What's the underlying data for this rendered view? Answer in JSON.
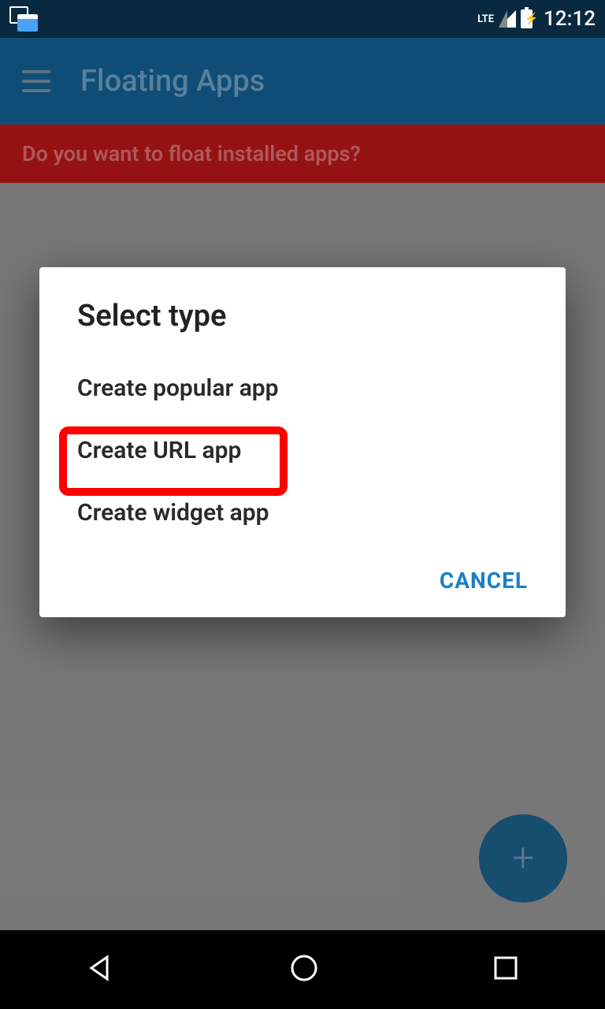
{
  "statusBar": {
    "time": "12:12",
    "lte": "LTE"
  },
  "appBar": {
    "title": "Floating Apps"
  },
  "banner": {
    "text": "Do you want to float installed apps?"
  },
  "fab": {
    "symbol": "+"
  },
  "dialog": {
    "title": "Select type",
    "options": [
      "Create popular app",
      "Create URL app",
      "Create widget app"
    ],
    "cancel": "CANCEL",
    "highlightedIndex": 1
  }
}
